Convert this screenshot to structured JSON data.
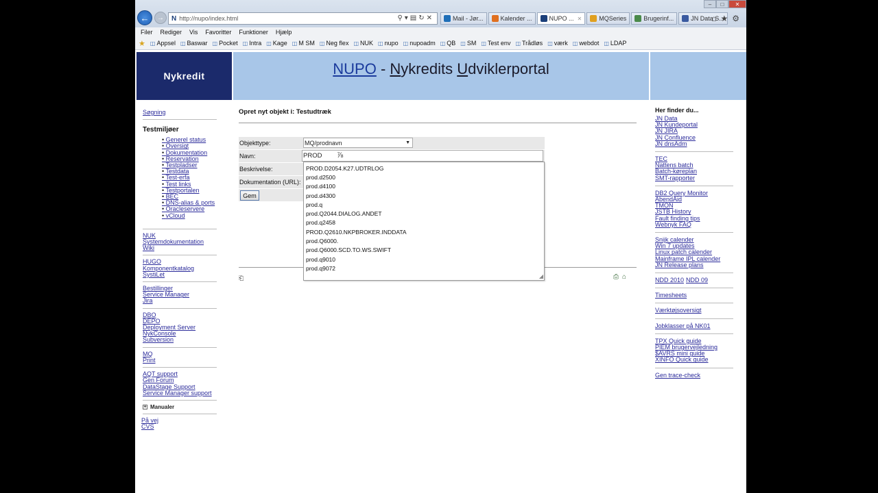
{
  "browser": {
    "url": "http://nupo/index.html",
    "tabs": [
      {
        "label": "Mail - Jør...",
        "icon_color": "#1f6fb8",
        "active": false
      },
      {
        "label": "Kalender ...",
        "icon_color": "#e07020",
        "active": false
      },
      {
        "label": "NUPO ...",
        "icon_color": "#1b3f7a",
        "active": true
      },
      {
        "label": "MQSeries",
        "icon_color": "#e0a020",
        "active": false
      },
      {
        "label": "Bruger­inf...",
        "icon_color": "#4a8a4a",
        "active": false
      },
      {
        "label": "JN Data S...",
        "icon_color": "#3a5aa0",
        "active": false
      }
    ],
    "menu": [
      "Filer",
      "Rediger",
      "Vis",
      "Favoritter",
      "Funktioner",
      "Hjælp"
    ],
    "favorites": [
      "Appsel",
      "Baswar",
      "Pocket",
      "Intra",
      "Kage",
      "M SM",
      "Neg flex",
      "NUK",
      "nupo",
      "nupoadm",
      "QB",
      "SM",
      "Test env",
      "Trådløs",
      "værk",
      "webdot",
      "LDAP"
    ]
  },
  "header": {
    "logo": "Nykredit",
    "title_link": "NUPO",
    "title_sep": " - ",
    "title_n": "N",
    "title_rest1": "ykredits ",
    "title_u": "U",
    "title_rest2": "dviklerportal"
  },
  "left_nav": {
    "search": "Søgning",
    "testenv_heading": "Testmiljøer",
    "testenv_items": [
      "Generel status",
      "Oversigt",
      "Dokumentation",
      "Reservation",
      "Testpladser",
      "Testdata",
      "Test-erfa",
      "Test links",
      "Testportalen",
      "BEC",
      "DNS-alias & ports",
      "Oracleservere",
      "vCloud"
    ],
    "group1": [
      "NUK",
      "Systemdokumentation",
      "Wiki"
    ],
    "group2": [
      "HUGO",
      "Komponentkatalog",
      "SystiLet"
    ],
    "group3": [
      "Bestillinger",
      "Service Manager",
      "Jira"
    ],
    "group4": [
      "DBO",
      "DEPO",
      "Deployment Server",
      "NykConsole",
      "Subversion"
    ],
    "group5": [
      "MQ",
      "Print"
    ],
    "group6": [
      "AQT support",
      "Gen Forum",
      "DataStage Support",
      "Service Manager support"
    ],
    "manualer": "Manualer",
    "group7": [
      "På vej",
      "CVS"
    ]
  },
  "main": {
    "title": "Opret nyt objekt i: Testudtræk",
    "objekttype_label": "Objekttype:",
    "objekttype_value": "MQ/prodnavn",
    "navn_label": "Navn:",
    "navn_value": "PROD",
    "beskrivelse_label": "Beskrivelse:",
    "dokumentation_label": "Dokumentation (URL):",
    "save_label": "Gem",
    "suggestions": [
      "PROD.D2054.K27.UDTRLOG",
      "prod.d2500",
      "prod.d4100",
      "prod.d4300",
      "prod.q",
      "prod.Q2044.DIALOG.ANDET",
      "prod.q2458",
      "PROD.Q2610.NKPBROKER.INDDATA",
      "prod.Q6000.",
      "prod.Q6000.SCD.TO.WS.SWIFT",
      "prod.q9010",
      "prod.q9072"
    ]
  },
  "right_nav": {
    "heading": "Her finder du...",
    "group1": [
      "JN Data",
      "JN Kundeportal",
      "JN JIRA",
      "JN Confluence",
      "JN dnsAdm"
    ],
    "group2": [
      "TEC",
      "Nattens batch",
      "Batch-køreplan",
      "SMT-rapporter"
    ],
    "group3": [
      "DB2 Query Monitor",
      "AbendAid",
      "TMON",
      "JSTB History",
      "Fault finding tips",
      "Webnyk FAQ"
    ],
    "group4": [
      "Snijk calender",
      "Win 7 updates",
      "Linux patch calender",
      "Mainframe IPL calender",
      "JN Release plans"
    ],
    "ndd": [
      "NDD 2010",
      "NDD 09"
    ],
    "timesheets": "Timesheets",
    "vaerktoj": "Værktøjsoversigt",
    "jobklasser": "Jobklasser på NK01",
    "group5": [
      "TPX Quick guide",
      "PIEM brugervejledning",
      "$AVRS mini guide",
      "XINFO Quick guide"
    ],
    "gen_trace": "Gen trace-check"
  }
}
